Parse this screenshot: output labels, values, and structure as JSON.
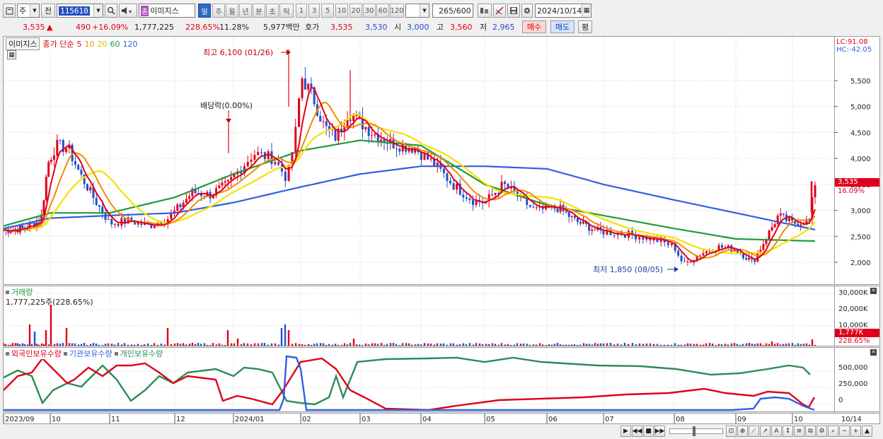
{
  "toolbar": {
    "market_label": "주",
    "prev_label": "전",
    "stock_code": "115610",
    "badge": "종",
    "stock_name": "이미지스",
    "periods": [
      "일",
      "주",
      "월",
      "년",
      "분",
      "초",
      "틱"
    ],
    "period_selected": "일",
    "intervals": [
      "1",
      "3",
      "5",
      "10",
      "20",
      "30",
      "60",
      "120"
    ],
    "count": "265",
    "count_total": "/600",
    "date": "2024/10/14"
  },
  "quote": {
    "price": "3,535",
    "price_arrow": "▲",
    "change": "490",
    "change_pct": "+16.09%",
    "volume": "1,777,225",
    "volume_ratio": "228.65%",
    "turnover": "11.28%",
    "amount": "5,977백만",
    "hoga_label": "호가",
    "ask": "3,535",
    "bid": "3,530",
    "open_label": "시",
    "open": "3,000",
    "high_label": "고",
    "high": "3,560",
    "low_label": "저",
    "low": "2,965",
    "buy_label": "매수",
    "sell_label": "매도",
    "eval_label": "평"
  },
  "price_chart": {
    "title": "이미지스",
    "legend_prefix": "종가 단순",
    "ma_periods": [
      {
        "label": "5",
        "color": "#e0001b"
      },
      {
        "label": "10",
        "color": "#f08c00"
      },
      {
        "label": "20",
        "color": "#f5e100"
      },
      {
        "label": "60",
        "color": "#1f9a3c"
      },
      {
        "label": "120",
        "color": "#3060e0"
      }
    ],
    "high_annotation": "최고 6,100 (01/26)",
    "low_annotation": "최저 1,850 (08/05)",
    "dividend_annotation": "배당락(0.00%)",
    "lc_label": "LC:91.08",
    "hc_label": "HC:-42.05",
    "price_ticks": [
      "5,500",
      "5,000",
      "4,500",
      "4,000",
      "3,500",
      "3,000",
      "2,500",
      "2,000"
    ],
    "current_price_tag": "3,535",
    "current_change_tag": "16.09%"
  },
  "volume_chart": {
    "title": "거래량",
    "value_label": "1,777,225주(228.65%)",
    "ticks": [
      "30,000K",
      "20,000K",
      "10,000K"
    ],
    "current_tag": "1,777K",
    "ratio_tag": "228.65%"
  },
  "holding_chart": {
    "series": [
      {
        "name": "외국인보유수량",
        "color": "#e0001b"
      },
      {
        "name": "기관보유수량",
        "color": "#3060e0"
      },
      {
        "name": "개인보유수량",
        "color": "#2e8b57"
      }
    ],
    "ticks": [
      "500,000",
      "250,000",
      "0"
    ]
  },
  "date_axis": {
    "labels": [
      "2023/09",
      "10",
      "11",
      "12",
      "2024/01",
      "02",
      "03",
      "04",
      "05",
      "06",
      "07",
      "08",
      "09",
      "10"
    ],
    "last_date": "10/14"
  },
  "colors": {
    "up": "#e0001b",
    "down": "#1f4fd0",
    "ma5": "#e0001b",
    "ma10": "#f08c00",
    "ma20": "#f5e100",
    "ma60": "#1f9a3c",
    "ma120": "#3060e0"
  },
  "chart_data": {
    "type": "candlestick",
    "x": [
      "2023/09",
      "2023/10",
      "2023/11",
      "2023/12",
      "2024/01",
      "2024/02",
      "2024/03",
      "2024/04",
      "2024/05",
      "2024/06",
      "2024/07",
      "2024/08",
      "2024/09",
      "2024/10"
    ],
    "close_approx": [
      2620,
      3500,
      2750,
      2850,
      4300,
      4300,
      4200,
      3700,
      3200,
      2900,
      2550,
      2200,
      2250,
      3535
    ],
    "ma60_approx": [
      2700,
      2950,
      2950,
      3250,
      3700,
      4150,
      4350,
      4250,
      3500,
      3100,
      2900,
      2650,
      2450,
      2420
    ],
    "ma120_approx": [
      2650,
      2850,
      2900,
      2950,
      3150,
      3450,
      3700,
      3850,
      3850,
      3800,
      3500,
      3200,
      2950,
      2720
    ],
    "ylim": [
      1800,
      6100
    ],
    "high": 6100,
    "low": 1850
  }
}
